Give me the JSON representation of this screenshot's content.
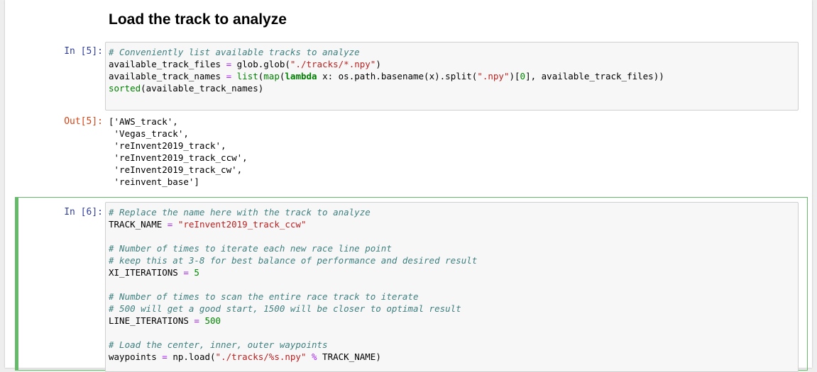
{
  "heading": "Load the track to analyze",
  "cell5": {
    "in_prompt": "In [5]:",
    "lines": [
      [
        {
          "t": "c",
          "v": "# Conveniently list available tracks to analyze"
        }
      ],
      [
        {
          "t": "p",
          "v": "available_track_files "
        },
        {
          "t": "o",
          "v": "="
        },
        {
          "t": "p",
          "v": " glob.glob("
        },
        {
          "t": "s",
          "v": "\"./tracks/*.npy\""
        },
        {
          "t": "p",
          "v": ")"
        }
      ],
      [
        {
          "t": "p",
          "v": "available_track_names "
        },
        {
          "t": "o",
          "v": "="
        },
        {
          "t": "p",
          "v": " "
        },
        {
          "t": "b",
          "v": "list"
        },
        {
          "t": "p",
          "v": "("
        },
        {
          "t": "b",
          "v": "map"
        },
        {
          "t": "p",
          "v": "("
        },
        {
          "t": "k",
          "v": "lambda"
        },
        {
          "t": "p",
          "v": " x: os.path.basename(x).split("
        },
        {
          "t": "s",
          "v": "\".npy\""
        },
        {
          "t": "p",
          "v": ")["
        },
        {
          "t": "n",
          "v": "0"
        },
        {
          "t": "p",
          "v": "], available_track_files))"
        }
      ],
      [
        {
          "t": "b",
          "v": "sorted"
        },
        {
          "t": "p",
          "v": "(available_track_names)"
        }
      ]
    ],
    "out_prompt": "Out[5]:",
    "output": "['AWS_track',\n 'Vegas_track',\n 'reInvent2019_track',\n 'reInvent2019_track_ccw',\n 'reInvent2019_track_cw',\n 'reinvent_base']"
  },
  "cell6": {
    "in_prompt": "In [6]:",
    "lines": [
      [
        {
          "t": "c",
          "v": "# Replace the name here with the track to analyze"
        }
      ],
      [
        {
          "t": "p",
          "v": "TRACK_NAME "
        },
        {
          "t": "o",
          "v": "="
        },
        {
          "t": "p",
          "v": " "
        },
        {
          "t": "s",
          "v": "\"reInvent2019_track_ccw\""
        }
      ],
      [],
      [
        {
          "t": "c",
          "v": "# Number of times to iterate each new race line point"
        }
      ],
      [
        {
          "t": "c",
          "v": "# keep this at 3-8 for best balance of performance and desired result"
        }
      ],
      [
        {
          "t": "p",
          "v": "XI_ITERATIONS "
        },
        {
          "t": "o",
          "v": "="
        },
        {
          "t": "p",
          "v": " "
        },
        {
          "t": "n",
          "v": "5"
        }
      ],
      [],
      [
        {
          "t": "c",
          "v": "# Number of times to scan the entire race track to iterate"
        }
      ],
      [
        {
          "t": "c",
          "v": "# 500 will get a good start, 1500 will be closer to optimal result"
        }
      ],
      [
        {
          "t": "p",
          "v": "LINE_ITERATIONS "
        },
        {
          "t": "o",
          "v": "="
        },
        {
          "t": "p",
          "v": " "
        },
        {
          "t": "n",
          "v": "500"
        }
      ],
      [],
      [
        {
          "t": "c",
          "v": "# Load the center, inner, outer waypoints"
        }
      ],
      [
        {
          "t": "p",
          "v": "waypoints "
        },
        {
          "t": "o",
          "v": "="
        },
        {
          "t": "p",
          "v": " np.load("
        },
        {
          "t": "s",
          "v": "\"./tracks/%s.npy\""
        },
        {
          "t": "p",
          "v": " "
        },
        {
          "t": "o",
          "v": "%"
        },
        {
          "t": "p",
          "v": " TRACK_NAME)"
        }
      ]
    ]
  }
}
